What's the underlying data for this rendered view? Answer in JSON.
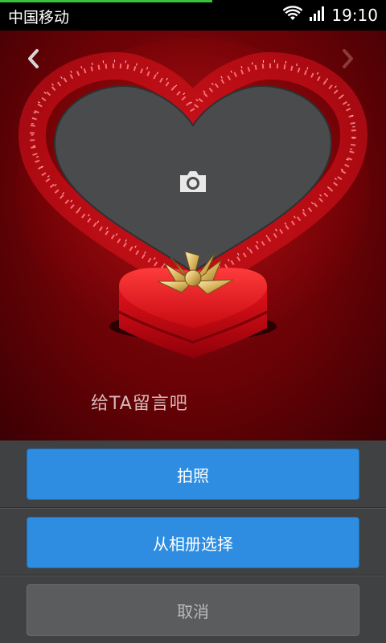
{
  "status_bar": {
    "carrier": "中国移动",
    "time": "19:10",
    "icons": [
      "wifi-icon",
      "signal-icon"
    ]
  },
  "photo_frame": {
    "prev_icon": "chevron-left-icon",
    "next_icon": "chevron-right-icon",
    "camera_icon": "camera-icon",
    "message_label": "给TA留言吧"
  },
  "action_sheet": {
    "take_photo_label": "拍照",
    "choose_from_album_label": "从相册选择",
    "cancel_label": "取消"
  },
  "colors": {
    "primary_button": "#2e8de0",
    "sheet_background": "#3f4142",
    "stage_background": "#6a0206"
  }
}
